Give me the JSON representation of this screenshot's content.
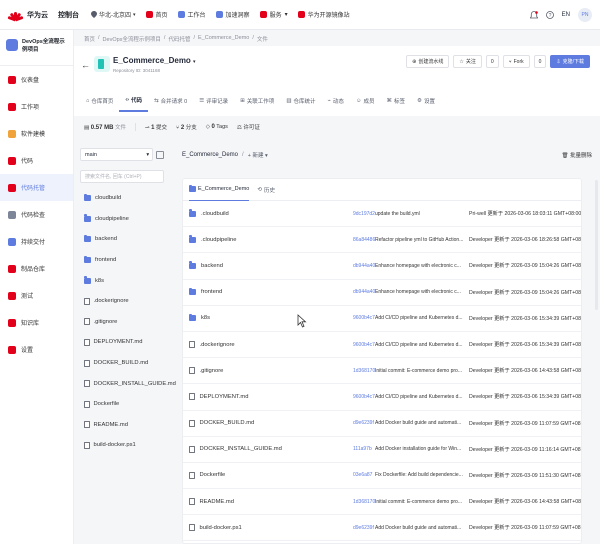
{
  "topbar": {
    "brand": "华为云",
    "console": "控制台",
    "region": "华北-北京四",
    "nav": [
      {
        "label": "首页",
        "color": "#e3001b"
      },
      {
        "label": "工作台",
        "color": "#5e7ce0"
      },
      {
        "label": "加速洞察",
        "color": "#5e7ce0"
      },
      {
        "label": "服务",
        "color": "#e3001b"
      },
      {
        "label": "华为开源镜像站",
        "color": "#e3001b"
      }
    ],
    "user": "EN",
    "avatar": "PN"
  },
  "sidebar": {
    "project": "DevOps全流程示例项目",
    "items": [
      {
        "label": "仪表盘",
        "color": "#e3001b",
        "active": false
      },
      {
        "label": "工作项",
        "color": "#e3001b",
        "active": false
      },
      {
        "label": "软件建模",
        "color": "#f0a23b",
        "active": false
      },
      {
        "label": "代码",
        "color": "#e3001b",
        "active": false
      },
      {
        "label": "代码托管",
        "color": "#e3001b",
        "active": true
      },
      {
        "label": "代码检查",
        "color": "#7d8599",
        "active": false
      },
      {
        "label": "持续交付",
        "color": "#5e7ce0",
        "active": false
      },
      {
        "label": "制品仓库",
        "color": "#e3001b",
        "active": false
      },
      {
        "label": "测试",
        "color": "#e3001b",
        "active": false
      },
      {
        "label": "知识库",
        "color": "#e3001b",
        "active": false
      },
      {
        "label": "设置",
        "color": "#e3001b",
        "active": false
      }
    ]
  },
  "breadcrumb": [
    "首页",
    "/",
    "DevOps全流程示例项目",
    "/",
    "代码托管",
    "/",
    "E_Commerce_Demo",
    "/",
    "文件"
  ],
  "repo": {
    "name": "E_Commerce_Demo",
    "id": "Repository ID: 3041168",
    "buttons": {
      "branch_flow": "创建流水线",
      "watch": "关注",
      "watch_count": "0",
      "fork": "Fork",
      "fork_count": "0",
      "clone": "克隆/下载"
    },
    "tabs": [
      "仓库首页",
      "代码",
      "合并请求 0",
      "评审记录",
      "关联工作项",
      "仓库统计",
      "动态",
      "成员",
      "标签",
      "设置"
    ]
  },
  "stats": {
    "size": "0.57 MB",
    "size_unit": "文件",
    "commits": "1",
    "commits_unit": "提交",
    "branches": "2",
    "branches_unit": "分支",
    "tags": "0",
    "tags_unit": "Tags",
    "license": "许可证"
  },
  "tree": {
    "branch": "main",
    "search_placeholder": "搜索文件名, 回车 (Ctrl+P)",
    "items": [
      {
        "name": "cloudbuild",
        "type": "folder"
      },
      {
        "name": "cloudpipeline",
        "type": "folder"
      },
      {
        "name": "backend",
        "type": "folder"
      },
      {
        "name": "frontend",
        "type": "folder"
      },
      {
        "name": "k8s",
        "type": "folder"
      },
      {
        "name": ".dockerignore",
        "type": "file"
      },
      {
        "name": ".gitignore",
        "type": "file"
      },
      {
        "name": "DEPLOYMENT.md",
        "type": "file"
      },
      {
        "name": "DOCKER_BUILD.md",
        "type": "file"
      },
      {
        "name": "DOCKER_INSTALL_GUIDE.md",
        "type": "file"
      },
      {
        "name": "Dockerfile",
        "type": "file"
      },
      {
        "name": "README.md",
        "type": "file"
      },
      {
        "name": "build-docker.ps1",
        "type": "file"
      }
    ]
  },
  "main": {
    "path": "E_Commerce_Demo",
    "path_sep": "/",
    "new_label": "+ 新建",
    "batch_delete": "批量删除",
    "tabs": [
      "E_Commerce_Demo",
      "历史"
    ],
    "files": [
      {
        "name": ".cloudbuild",
        "type": "folder",
        "hash": "9dc197d2",
        "msg": "update the build.yml",
        "author": "Pri-well 更新于 2026-03-06 18:03:11 GMT+08:00"
      },
      {
        "name": ".cloudpipeline",
        "type": "folder",
        "hash": "86a84486",
        "msg": "Refactor pipeline yml to GitHub Action...",
        "author": "Developer 更新于 2026-03-06 18:26:58 GMT+08:00"
      },
      {
        "name": "backend",
        "type": "folder",
        "hash": "db944a40",
        "msg": "Enhance homepage with electronic c...",
        "author": "Developer 更新于 2026-03-09 15:04:26 GMT+08:00"
      },
      {
        "name": "frontend",
        "type": "folder",
        "hash": "db944a40",
        "msg": "Enhance homepage with electronic c...",
        "author": "Developer 更新于 2026-03-09 15:04:26 GMT+08:00"
      },
      {
        "name": "k8s",
        "type": "folder",
        "hash": "9600b4c7",
        "msg": "Add CI/CD pipeline and Kubernetes d...",
        "author": "Developer 更新于 2026-03-06 15:34:39 GMT+08:00"
      },
      {
        "name": ".dockerignore",
        "type": "file",
        "hash": "9600b4c7",
        "msg": "Add CI/CD pipeline and Kubernetes d...",
        "author": "Developer 更新于 2026-03-06 15:34:39 GMT+08:00"
      },
      {
        "name": ".gitignore",
        "type": "file",
        "hash": "1d368170",
        "msg": "Initial commit: E-commerce demo pro...",
        "author": "Developer 更新于 2026-03-06 14:43:58 GMT+08:00"
      },
      {
        "name": "DEPLOYMENT.md",
        "type": "file",
        "hash": "9600b4c7",
        "msg": "Add CI/CD pipeline and Kubernetes d...",
        "author": "Developer 更新于 2026-03-06 15:34:39 GMT+08:00"
      },
      {
        "name": "DOCKER_BUILD.md",
        "type": "file",
        "hash": "d9e6239f",
        "msg": "Add Docker build guide and automati...",
        "author": "Developer 更新于 2026-03-09 11:07:59 GMT+08:00"
      },
      {
        "name": "DOCKER_INSTALL_GUIDE.md",
        "type": "file",
        "hash": "111a97b",
        "msg": "Add Docker installation guide for Win...",
        "author": "Developer 更新于 2026-03-09 11:16:14 GMT+08:00"
      },
      {
        "name": "Dockerfile",
        "type": "file",
        "hash": "03e6a87",
        "msg": "Fix Dockerfile: Add build dependencie...",
        "author": "Developer 更新于 2026-03-09 11:51:30 GMT+08:00"
      },
      {
        "name": "README.md",
        "type": "file",
        "hash": "1d368170",
        "msg": "Initial commit: E-commerce demo pro...",
        "author": "Developer 更新于 2026-03-06 14:43:58 GMT+08:00"
      },
      {
        "name": "build-docker.ps1",
        "type": "file",
        "hash": "d9e6239f",
        "msg": "Add Docker build guide and automati...",
        "author": "Developer 更新于 2026-03-09 11:07:59 GMT+08:00"
      }
    ]
  }
}
